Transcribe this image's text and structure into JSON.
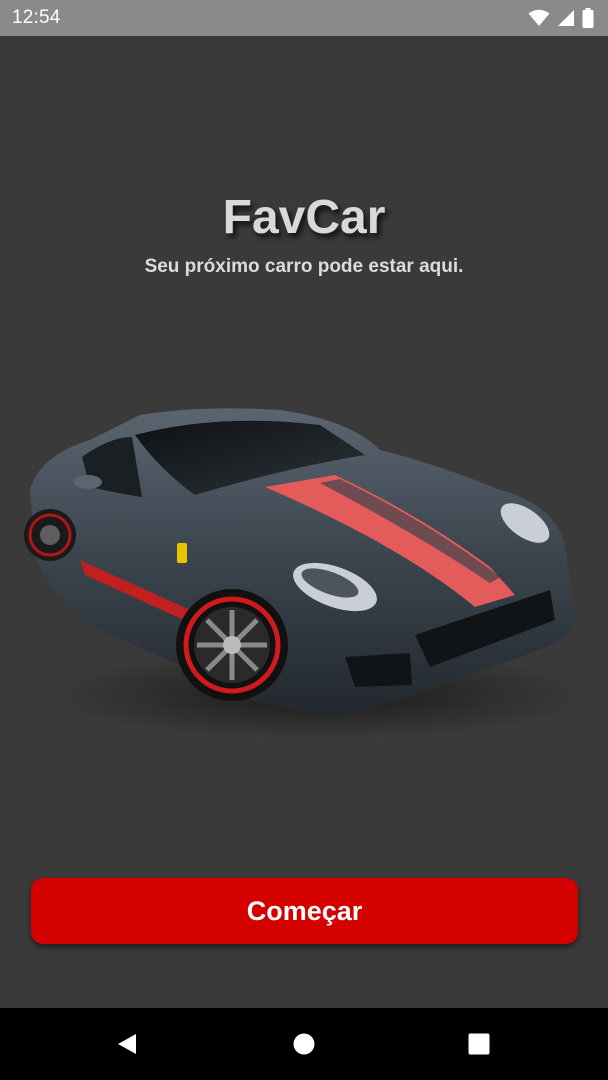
{
  "status_bar": {
    "time": "12:54",
    "icons": [
      "wifi-icon",
      "cellular-signal-icon",
      "battery-icon"
    ]
  },
  "header": {
    "title": "FavCar",
    "subtitle": "Seu próximo carro pode estar aqui."
  },
  "hero": {
    "image": "sports-car-illustration"
  },
  "actions": {
    "start_label": "Começar"
  },
  "nav_bar": {
    "icons": [
      "back-icon",
      "home-icon",
      "recents-icon"
    ]
  },
  "colors": {
    "background": "#3a3a3a",
    "status_bar": "#8a8a8a",
    "button": "#d40000",
    "nav_bar": "#000000"
  }
}
